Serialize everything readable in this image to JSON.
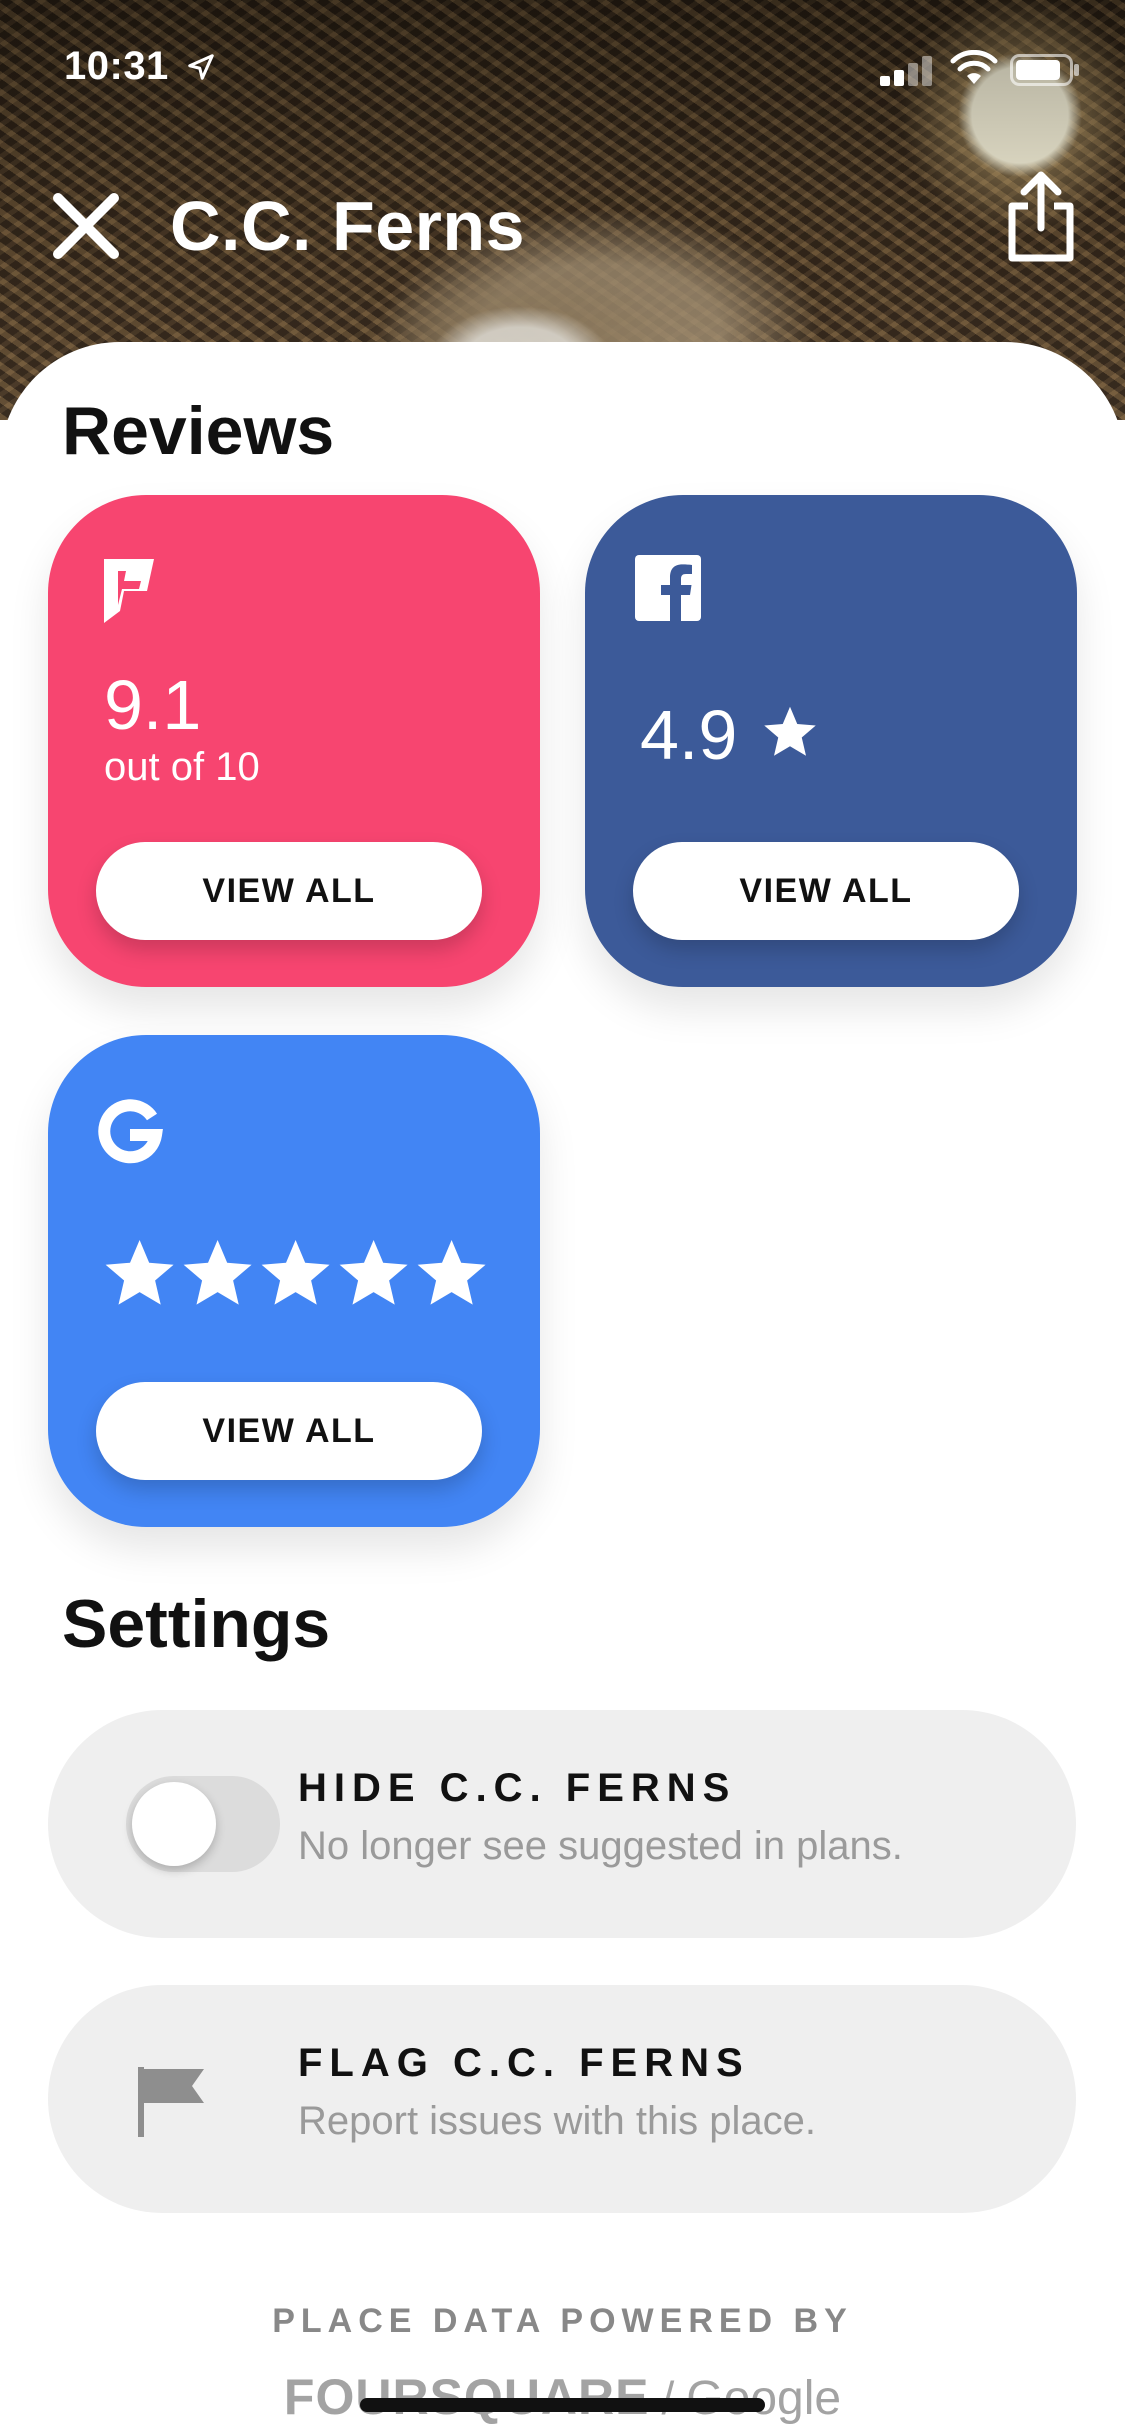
{
  "status_bar": {
    "time": "10:31"
  },
  "header": {
    "title": "C.C. Ferns",
    "close_icon": "close-icon",
    "share_icon": "share-icon"
  },
  "reviews": {
    "title": "Reviews",
    "foursquare": {
      "score": "9.1",
      "subtitle": "out of 10",
      "button": "VIEW ALL",
      "color": "#F74570",
      "icon": "foursquare-icon"
    },
    "facebook": {
      "rating": "4.9",
      "button": "VIEW ALL",
      "color": "#3C5A99",
      "icon": "facebook-icon"
    },
    "google": {
      "stars": 5,
      "button": "VIEW ALL",
      "color": "#4285F4",
      "icon": "google-icon"
    }
  },
  "settings": {
    "title": "Settings",
    "hide": {
      "title": "HIDE C.C. FERNS",
      "subtitle": "No longer see suggested in plans.",
      "enabled": false
    },
    "flag": {
      "title": "FLAG C.C. FERNS",
      "subtitle": "Report issues with this place.",
      "icon": "flag-icon"
    }
  },
  "footer": {
    "powered_by": "PLACE DATA POWERED BY",
    "brand_1": "FOURSQUARE",
    "separator": "/",
    "brand_2": "Google"
  }
}
